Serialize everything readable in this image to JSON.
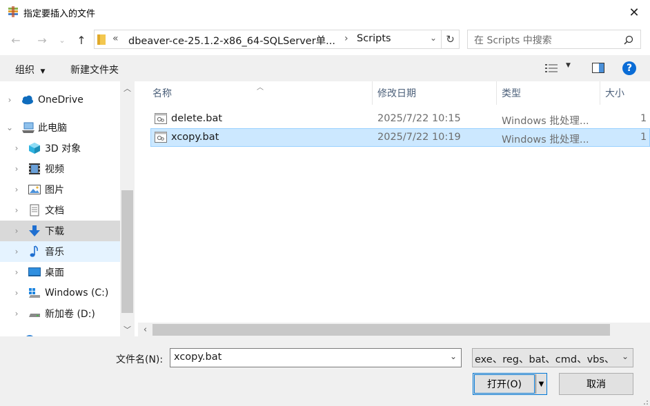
{
  "window": {
    "title": "指定要插入的文件"
  },
  "address": {
    "overflow": "«",
    "crumbs": [
      "dbeaver-ce-25.1.2-x86_64-SQLServer单...",
      "Scripts"
    ],
    "separator": "›"
  },
  "search": {
    "placeholder": "在 Scripts 中搜索"
  },
  "toolbar": {
    "organize": "组织",
    "new_folder": "新建文件夹"
  },
  "nav": {
    "items": [
      {
        "label": "OneDrive",
        "icon": "cloud-icon"
      },
      {
        "label": "此电脑",
        "icon": "computer-icon"
      },
      {
        "label": "3D 对象",
        "icon": "3d-objects-icon"
      },
      {
        "label": "视频",
        "icon": "video-icon"
      },
      {
        "label": "图片",
        "icon": "pictures-icon"
      },
      {
        "label": "文档",
        "icon": "documents-icon"
      },
      {
        "label": "下载",
        "icon": "download-icon"
      },
      {
        "label": "音乐",
        "icon": "music-icon"
      },
      {
        "label": "桌面",
        "icon": "desktop-icon"
      },
      {
        "label": "Windows (C:)",
        "icon": "drive-c-icon"
      },
      {
        "label": "新加卷 (D:)",
        "icon": "drive-d-icon"
      }
    ]
  },
  "files": {
    "columns": [
      "名称",
      "修改日期",
      "类型",
      "大小"
    ],
    "rows": [
      {
        "name": "delete.bat",
        "modified": "2025/7/22 10:15",
        "type": "Windows 批处理...",
        "size": "1"
      },
      {
        "name": "xcopy.bat",
        "modified": "2025/7/22 10:19",
        "type": "Windows 批处理...",
        "size": "1"
      }
    ]
  },
  "bottom": {
    "filename_label": "文件名(N):",
    "filename_value": "xcopy.bat",
    "filter_value": "exe、reg、bat、cmd、vbs、",
    "open_label": "打开(O)",
    "cancel_label": "取消"
  },
  "colors": {
    "accent": "#0078d7",
    "selection": "#cce8ff",
    "selection_border": "#99d1ff",
    "header_text": "#4c607a"
  }
}
